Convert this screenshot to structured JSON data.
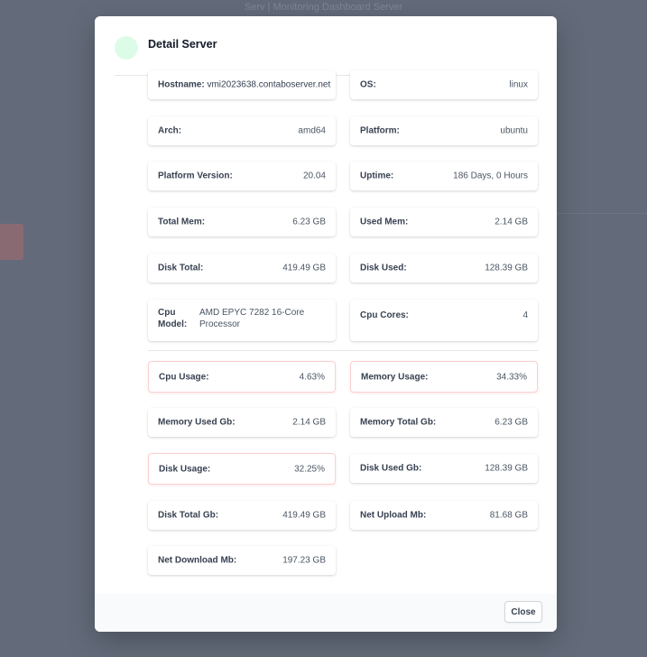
{
  "background": {
    "top_text": "Serv | Monitoring Dashboard Server"
  },
  "modal": {
    "title": "Detail Server",
    "status_color": "#dcfce7"
  },
  "server": {
    "hostname_label": "Hostname:",
    "hostname": "vmi2023638.contaboserver.net",
    "os_label": "OS:",
    "os": "linux",
    "arch_label": "Arch:",
    "arch": "amd64",
    "platform_label": "Platform:",
    "platform": "ubuntu",
    "platform_version_label": "Platform Version:",
    "platform_version": "20.04",
    "uptime_label": "Uptime:",
    "uptime": "186 Days, 0 Hours",
    "total_mem_label": "Total Mem:",
    "total_mem": "6.23 GB",
    "used_mem_label": "Used Mem:",
    "used_mem": "2.14 GB",
    "disk_total_label": "Disk Total:",
    "disk_total": "419.49 GB",
    "disk_used_label": "Disk Used:",
    "disk_used": "128.39 GB",
    "cpu_model_label": "Cpu Model:",
    "cpu_model": "AMD EPYC 7282 16-Core Processor",
    "cpu_cores_label": "Cpu Cores:",
    "cpu_cores": "4"
  },
  "metrics": {
    "cpu_usage_label": "Cpu Usage:",
    "cpu_usage": "4.63%",
    "memory_usage_label": "Memory Usage:",
    "memory_usage": "34.33%",
    "memory_used_gb_label": "Memory Used Gb:",
    "memory_used_gb": "2.14 GB",
    "memory_total_gb_label": "Memory Total Gb:",
    "memory_total_gb": "6.23 GB",
    "disk_usage_label": "Disk Usage:",
    "disk_usage": "32.25%",
    "disk_used_gb_label": "Disk Used Gb:",
    "disk_used_gb": "128.39 GB",
    "disk_total_gb_label": "Disk Total Gb:",
    "disk_total_gb": "419.49 GB",
    "net_upload_mb_label": "Net Upload Mb:",
    "net_upload_mb": "81.68 GB",
    "net_download_mb_label": "Net Download Mb:",
    "net_download_mb": "197.23 GB"
  },
  "footer": {
    "close_label": "Close"
  }
}
